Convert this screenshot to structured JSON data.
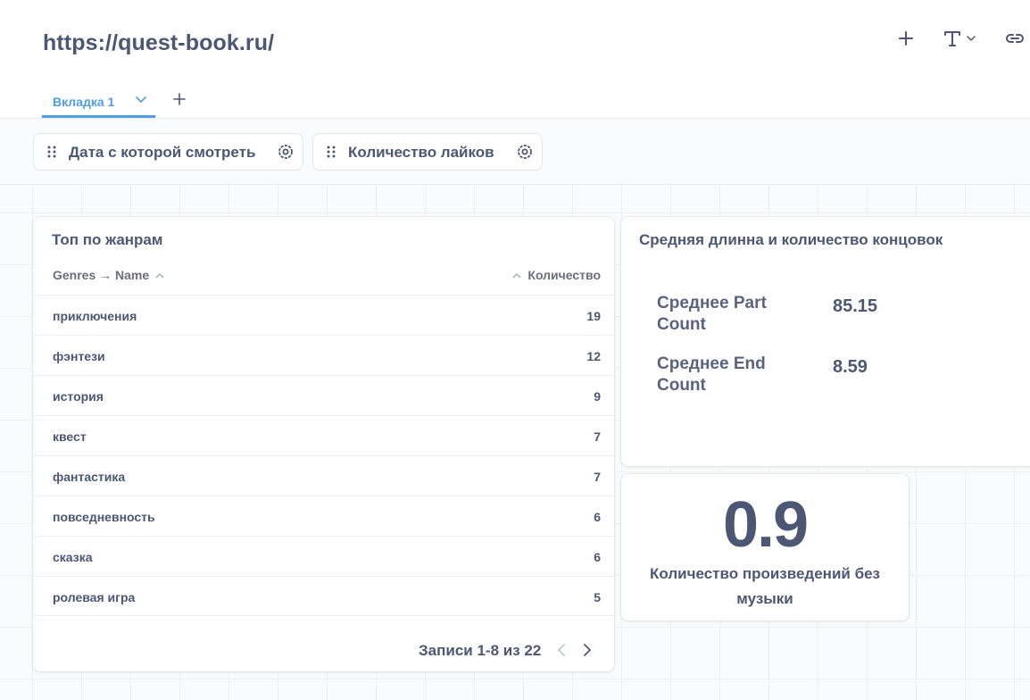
{
  "header": {
    "title": "https://quest-book.ru/",
    "actions": [
      "add-icon",
      "text-icon",
      "link-icon"
    ]
  },
  "tabs": [
    {
      "label": "Вкладка 1",
      "active": true
    }
  ],
  "filters": [
    {
      "label": "Дата с которой смотреть"
    },
    {
      "label": "Количество лайков"
    }
  ],
  "table_card": {
    "title": "Топ по жанрам",
    "columns": [
      "Genres → Name",
      "Количество"
    ],
    "rows": [
      {
        "name": "приключения",
        "count": "19"
      },
      {
        "name": "фэнтези",
        "count": "12"
      },
      {
        "name": "история",
        "count": "9"
      },
      {
        "name": "квест",
        "count": "7"
      },
      {
        "name": "фантастика",
        "count": "7"
      },
      {
        "name": "повседневность",
        "count": "6"
      },
      {
        "name": "сказка",
        "count": "6"
      },
      {
        "name": "ролевая игра",
        "count": "5"
      }
    ],
    "pagination": "Записи 1-8 из 22"
  },
  "avg_card": {
    "title": "Средняя длинна и количество концовок",
    "items": [
      {
        "label": "Среднее Part Count",
        "value": "85.15"
      },
      {
        "label": "Среднее End Count",
        "value": "8.59"
      }
    ]
  },
  "big_card": {
    "value": "0.9",
    "caption": "Количество произведений без музыки"
  },
  "colors": {
    "accent": "#509ee3",
    "text": "#4c5773",
    "background": "#f9fbfc"
  }
}
